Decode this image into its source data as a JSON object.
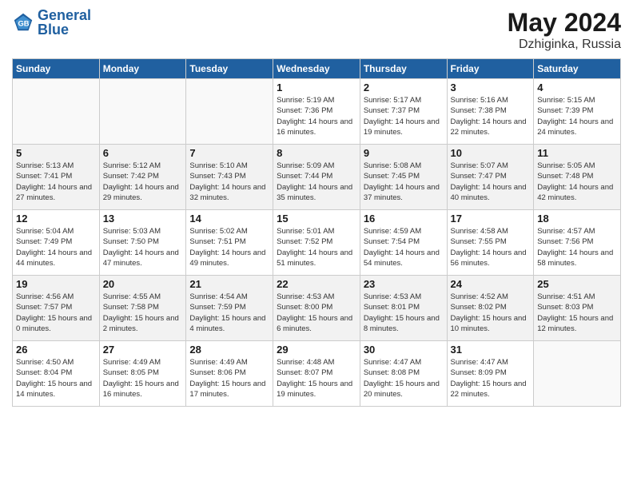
{
  "header": {
    "logo_general": "General",
    "logo_blue": "Blue",
    "month": "May 2024",
    "location": "Dzhiginka, Russia"
  },
  "days_of_week": [
    "Sunday",
    "Monday",
    "Tuesday",
    "Wednesday",
    "Thursday",
    "Friday",
    "Saturday"
  ],
  "weeks": [
    [
      {
        "day": "",
        "sunrise": "",
        "sunset": "",
        "daylight": ""
      },
      {
        "day": "",
        "sunrise": "",
        "sunset": "",
        "daylight": ""
      },
      {
        "day": "",
        "sunrise": "",
        "sunset": "",
        "daylight": ""
      },
      {
        "day": "1",
        "sunrise": "Sunrise: 5:19 AM",
        "sunset": "Sunset: 7:36 PM",
        "daylight": "Daylight: 14 hours and 16 minutes."
      },
      {
        "day": "2",
        "sunrise": "Sunrise: 5:17 AM",
        "sunset": "Sunset: 7:37 PM",
        "daylight": "Daylight: 14 hours and 19 minutes."
      },
      {
        "day": "3",
        "sunrise": "Sunrise: 5:16 AM",
        "sunset": "Sunset: 7:38 PM",
        "daylight": "Daylight: 14 hours and 22 minutes."
      },
      {
        "day": "4",
        "sunrise": "Sunrise: 5:15 AM",
        "sunset": "Sunset: 7:39 PM",
        "daylight": "Daylight: 14 hours and 24 minutes."
      }
    ],
    [
      {
        "day": "5",
        "sunrise": "Sunrise: 5:13 AM",
        "sunset": "Sunset: 7:41 PM",
        "daylight": "Daylight: 14 hours and 27 minutes."
      },
      {
        "day": "6",
        "sunrise": "Sunrise: 5:12 AM",
        "sunset": "Sunset: 7:42 PM",
        "daylight": "Daylight: 14 hours and 29 minutes."
      },
      {
        "day": "7",
        "sunrise": "Sunrise: 5:10 AM",
        "sunset": "Sunset: 7:43 PM",
        "daylight": "Daylight: 14 hours and 32 minutes."
      },
      {
        "day": "8",
        "sunrise": "Sunrise: 5:09 AM",
        "sunset": "Sunset: 7:44 PM",
        "daylight": "Daylight: 14 hours and 35 minutes."
      },
      {
        "day": "9",
        "sunrise": "Sunrise: 5:08 AM",
        "sunset": "Sunset: 7:45 PM",
        "daylight": "Daylight: 14 hours and 37 minutes."
      },
      {
        "day": "10",
        "sunrise": "Sunrise: 5:07 AM",
        "sunset": "Sunset: 7:47 PM",
        "daylight": "Daylight: 14 hours and 40 minutes."
      },
      {
        "day": "11",
        "sunrise": "Sunrise: 5:05 AM",
        "sunset": "Sunset: 7:48 PM",
        "daylight": "Daylight: 14 hours and 42 minutes."
      }
    ],
    [
      {
        "day": "12",
        "sunrise": "Sunrise: 5:04 AM",
        "sunset": "Sunset: 7:49 PM",
        "daylight": "Daylight: 14 hours and 44 minutes."
      },
      {
        "day": "13",
        "sunrise": "Sunrise: 5:03 AM",
        "sunset": "Sunset: 7:50 PM",
        "daylight": "Daylight: 14 hours and 47 minutes."
      },
      {
        "day": "14",
        "sunrise": "Sunrise: 5:02 AM",
        "sunset": "Sunset: 7:51 PM",
        "daylight": "Daylight: 14 hours and 49 minutes."
      },
      {
        "day": "15",
        "sunrise": "Sunrise: 5:01 AM",
        "sunset": "Sunset: 7:52 PM",
        "daylight": "Daylight: 14 hours and 51 minutes."
      },
      {
        "day": "16",
        "sunrise": "Sunrise: 4:59 AM",
        "sunset": "Sunset: 7:54 PM",
        "daylight": "Daylight: 14 hours and 54 minutes."
      },
      {
        "day": "17",
        "sunrise": "Sunrise: 4:58 AM",
        "sunset": "Sunset: 7:55 PM",
        "daylight": "Daylight: 14 hours and 56 minutes."
      },
      {
        "day": "18",
        "sunrise": "Sunrise: 4:57 AM",
        "sunset": "Sunset: 7:56 PM",
        "daylight": "Daylight: 14 hours and 58 minutes."
      }
    ],
    [
      {
        "day": "19",
        "sunrise": "Sunrise: 4:56 AM",
        "sunset": "Sunset: 7:57 PM",
        "daylight": "Daylight: 15 hours and 0 minutes."
      },
      {
        "day": "20",
        "sunrise": "Sunrise: 4:55 AM",
        "sunset": "Sunset: 7:58 PM",
        "daylight": "Daylight: 15 hours and 2 minutes."
      },
      {
        "day": "21",
        "sunrise": "Sunrise: 4:54 AM",
        "sunset": "Sunset: 7:59 PM",
        "daylight": "Daylight: 15 hours and 4 minutes."
      },
      {
        "day": "22",
        "sunrise": "Sunrise: 4:53 AM",
        "sunset": "Sunset: 8:00 PM",
        "daylight": "Daylight: 15 hours and 6 minutes."
      },
      {
        "day": "23",
        "sunrise": "Sunrise: 4:53 AM",
        "sunset": "Sunset: 8:01 PM",
        "daylight": "Daylight: 15 hours and 8 minutes."
      },
      {
        "day": "24",
        "sunrise": "Sunrise: 4:52 AM",
        "sunset": "Sunset: 8:02 PM",
        "daylight": "Daylight: 15 hours and 10 minutes."
      },
      {
        "day": "25",
        "sunrise": "Sunrise: 4:51 AM",
        "sunset": "Sunset: 8:03 PM",
        "daylight": "Daylight: 15 hours and 12 minutes."
      }
    ],
    [
      {
        "day": "26",
        "sunrise": "Sunrise: 4:50 AM",
        "sunset": "Sunset: 8:04 PM",
        "daylight": "Daylight: 15 hours and 14 minutes."
      },
      {
        "day": "27",
        "sunrise": "Sunrise: 4:49 AM",
        "sunset": "Sunset: 8:05 PM",
        "daylight": "Daylight: 15 hours and 16 minutes."
      },
      {
        "day": "28",
        "sunrise": "Sunrise: 4:49 AM",
        "sunset": "Sunset: 8:06 PM",
        "daylight": "Daylight: 15 hours and 17 minutes."
      },
      {
        "day": "29",
        "sunrise": "Sunrise: 4:48 AM",
        "sunset": "Sunset: 8:07 PM",
        "daylight": "Daylight: 15 hours and 19 minutes."
      },
      {
        "day": "30",
        "sunrise": "Sunrise: 4:47 AM",
        "sunset": "Sunset: 8:08 PM",
        "daylight": "Daylight: 15 hours and 20 minutes."
      },
      {
        "day": "31",
        "sunrise": "Sunrise: 4:47 AM",
        "sunset": "Sunset: 8:09 PM",
        "daylight": "Daylight: 15 hours and 22 minutes."
      },
      {
        "day": "",
        "sunrise": "",
        "sunset": "",
        "daylight": ""
      }
    ]
  ]
}
